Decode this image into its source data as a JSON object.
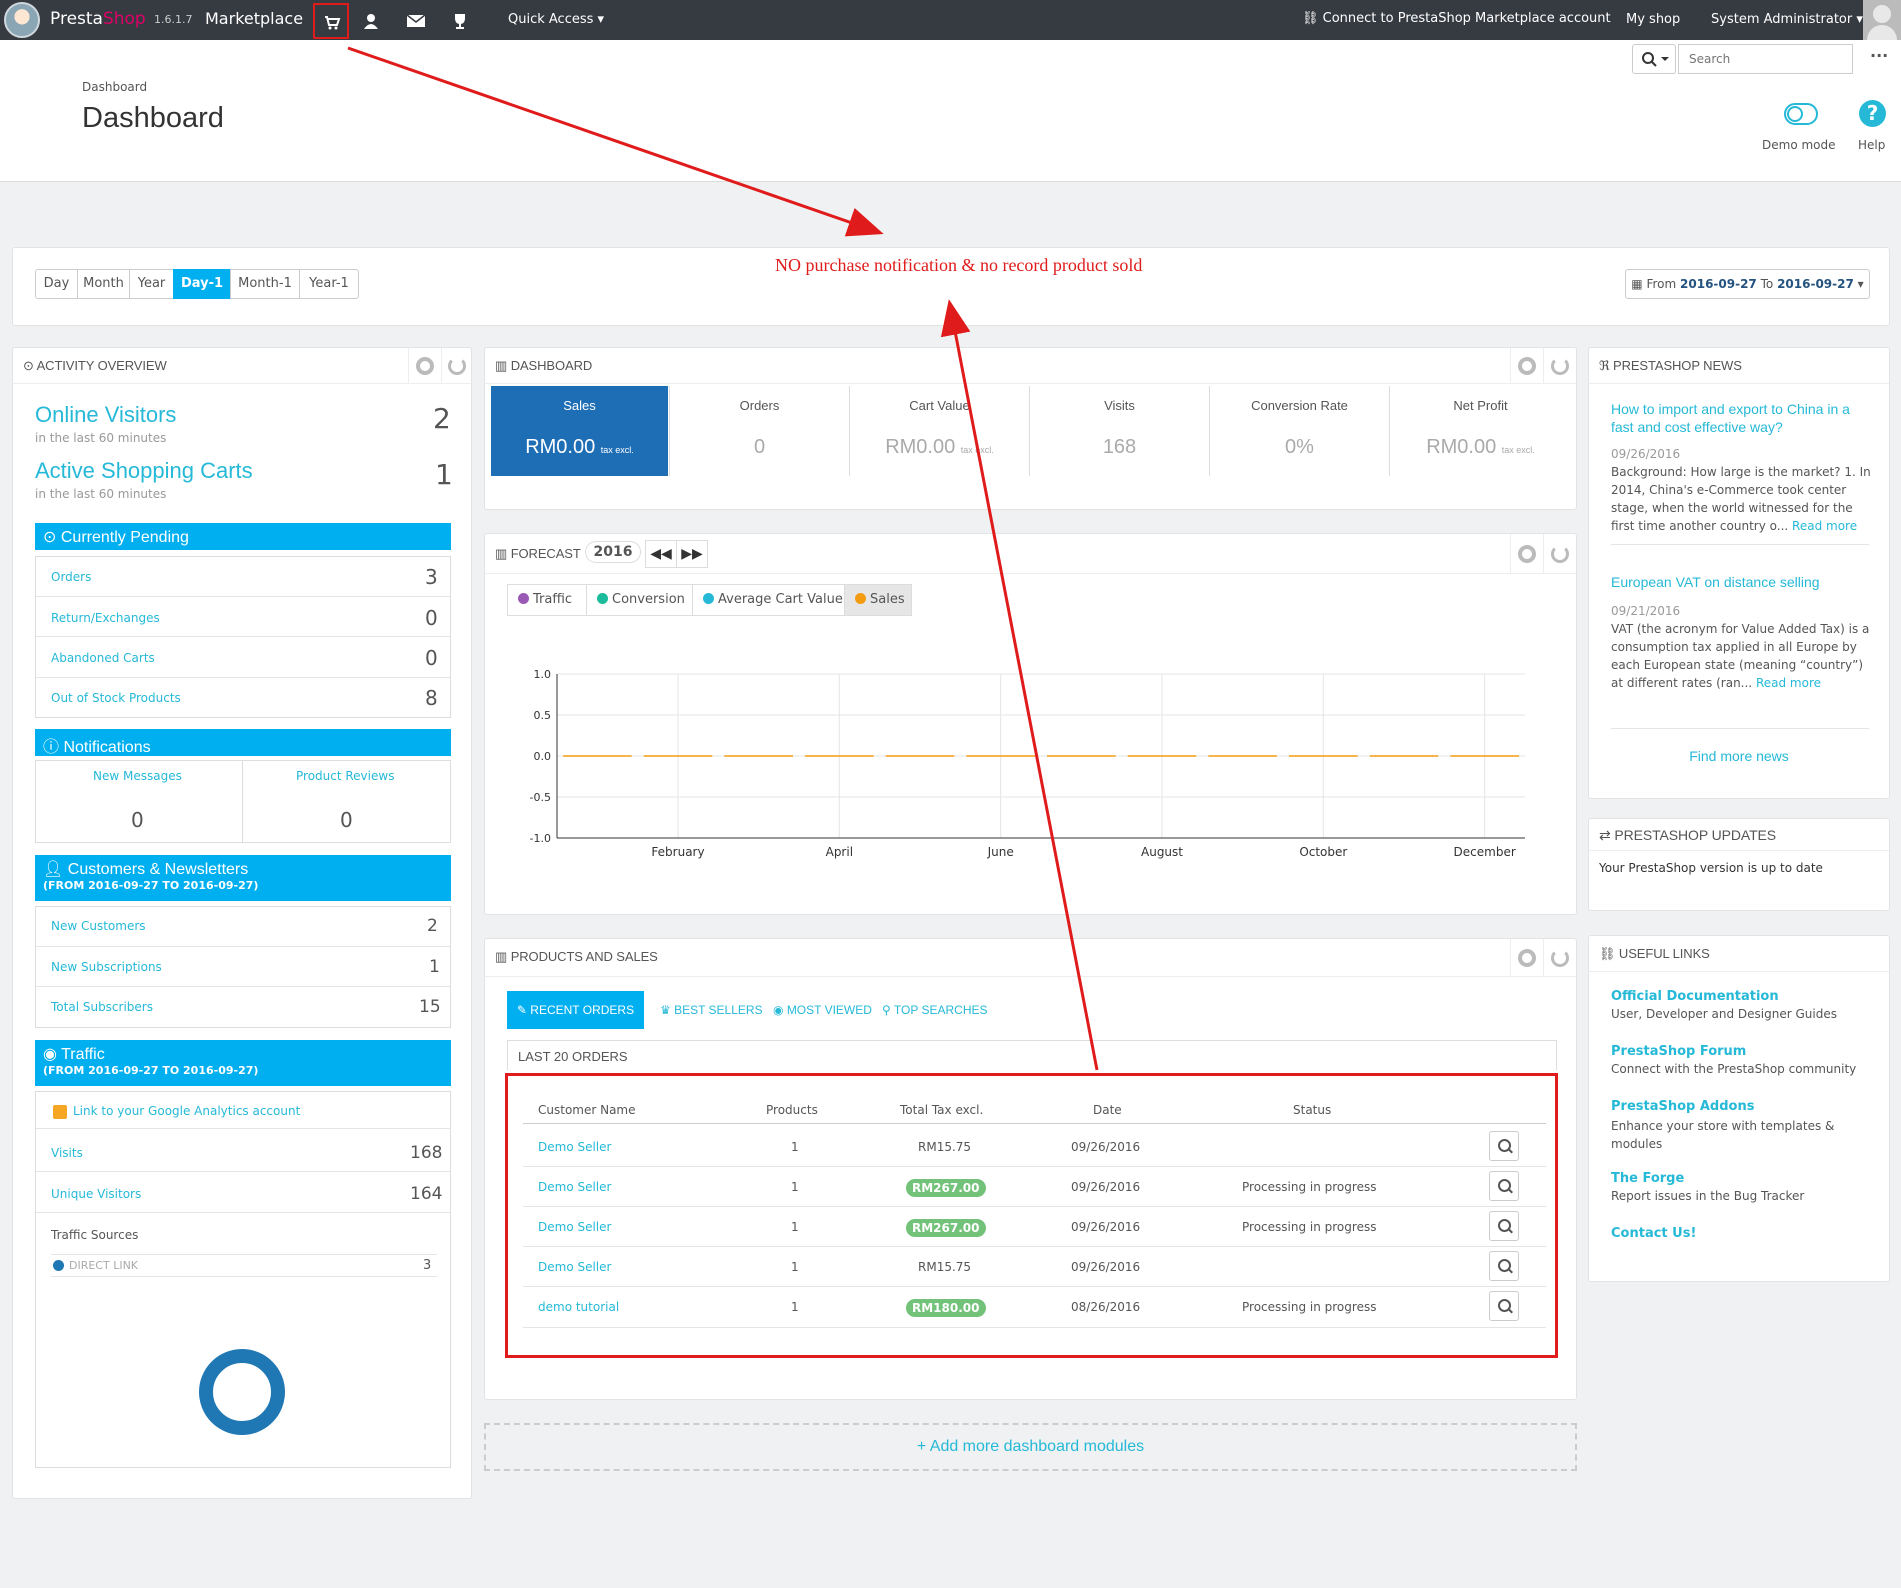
{
  "topbar": {
    "brand_a": "Presta",
    "brand_b": "Shop",
    "version": "1.6.1.7",
    "marketplace": "Marketplace",
    "quick_access": "Quick Access ▾",
    "connect": "Connect to PrestaShop Marketplace account",
    "my_shop": "My shop",
    "admin": "System Administrator ▾",
    "search_placeholder": "Search",
    "more": "···"
  },
  "header": {
    "breadcrumb": "Dashboard",
    "title": "Dashboard",
    "demo_mode": "Demo mode",
    "help": "Help"
  },
  "annotation": {
    "note": "NO purchase notification & no record product sold",
    "color": "#e01b1b"
  },
  "period": {
    "buttons": [
      "Day",
      "Month",
      "Year",
      "Day-1",
      "Month-1",
      "Year-1"
    ],
    "active": "Day-1",
    "range_prefix": "From",
    "from": "2016-09-27",
    "range_mid": "To",
    "to": "2016-09-27"
  },
  "activity": {
    "title": "ACTIVITY OVERVIEW",
    "online_visitors": "Online Visitors",
    "online_visitors_value": "2",
    "online_sub": "in the last 60 minutes",
    "active_carts": "Active Shopping Carts",
    "active_carts_value": "1",
    "carts_sub": "in the last 60 minutes",
    "pending_title": "Currently Pending",
    "pending": [
      {
        "label": "Orders",
        "value": "3"
      },
      {
        "label": "Return/Exchanges",
        "value": "0"
      },
      {
        "label": "Abandoned Carts",
        "value": "0"
      },
      {
        "label": "Out of Stock Products",
        "value": "8"
      }
    ],
    "notifications_title": "Notifications",
    "new_messages": "New Messages",
    "new_messages_value": "0",
    "product_reviews": "Product Reviews",
    "product_reviews_value": "0",
    "customers_title": "Customers & Newsletters",
    "customers_range": "(FROM 2016-09-27 TO 2016-09-27)",
    "customers": [
      {
        "label": "New Customers",
        "value": "2"
      },
      {
        "label": "New Subscriptions",
        "value": "1"
      },
      {
        "label": "Total Subscribers",
        "value": "15"
      }
    ],
    "traffic_title": "Traffic",
    "traffic_range": "(FROM 2016-09-27 TO 2016-09-27)",
    "analytics_link": "Link to your Google Analytics account",
    "traffic": [
      {
        "label": "Visits",
        "value": "168"
      },
      {
        "label": "Unique Visitors",
        "value": "164"
      }
    ],
    "traffic_sources": "Traffic Sources",
    "direct_link": "DIRECT LINK",
    "direct_link_value": "3"
  },
  "dashboard": {
    "title": "DASHBOARD",
    "kpis": [
      {
        "label": "Sales",
        "value": "RM0.00",
        "unit": "tax excl."
      },
      {
        "label": "Orders",
        "value": "0",
        "unit": ""
      },
      {
        "label": "Cart Value",
        "value": "RM0.00",
        "unit": "tax excl."
      },
      {
        "label": "Visits",
        "value": "168",
        "unit": ""
      },
      {
        "label": "Conversion Rate",
        "value": "0%",
        "unit": ""
      },
      {
        "label": "Net Profit",
        "value": "RM0.00",
        "unit": "tax excl."
      }
    ]
  },
  "forecast": {
    "title": "FORECAST",
    "year": "2016",
    "legend": [
      "Traffic",
      "Conversion",
      "Average Cart Value",
      "Sales"
    ],
    "legend_colors": [
      "#9b59b6",
      "#1abc9c",
      "#25b9d7",
      "#f39c12"
    ],
    "active_legend": "Sales"
  },
  "chart_data": {
    "type": "line",
    "x": [
      "January",
      "February",
      "March",
      "April",
      "May",
      "June",
      "July",
      "August",
      "September",
      "October",
      "November",
      "December"
    ],
    "xticks": [
      "February",
      "April",
      "June",
      "August",
      "October",
      "December"
    ],
    "yticks": [
      "1.0",
      "0.5",
      "0.0",
      "-0.5",
      "-1.0"
    ],
    "ylim": [
      -1,
      1
    ],
    "series": [
      {
        "name": "Sales",
        "values": [
          0,
          0,
          0,
          0,
          0,
          0,
          0,
          0,
          0,
          0,
          0,
          0
        ],
        "color": "#f39c12"
      }
    ]
  },
  "products_sales": {
    "title": "PRODUCTS AND SALES",
    "tabs": [
      "RECENT ORDERS",
      "BEST SELLERS",
      "MOST VIEWED",
      "TOP SEARCHES"
    ],
    "sub_title": "LAST 20 ORDERS",
    "columns": [
      "Customer Name",
      "Products",
      "Total Tax excl.",
      "Date",
      "Status"
    ],
    "rows": [
      {
        "customer": "Demo Seller",
        "products": "1",
        "total": "RM15.75",
        "badge": false,
        "date": "09/26/2016",
        "status": ""
      },
      {
        "customer": "Demo Seller",
        "products": "1",
        "total": "RM267.00",
        "badge": true,
        "date": "09/26/2016",
        "status": "Processing in progress"
      },
      {
        "customer": "Demo Seller",
        "products": "1",
        "total": "RM267.00",
        "badge": true,
        "date": "09/26/2016",
        "status": "Processing in progress"
      },
      {
        "customer": "Demo Seller",
        "products": "1",
        "total": "RM15.75",
        "badge": false,
        "date": "09/26/2016",
        "status": ""
      },
      {
        "customer": "demo tutorial",
        "products": "1",
        "total": "RM180.00",
        "badge": true,
        "date": "08/26/2016",
        "status": "Processing in progress"
      }
    ]
  },
  "add_modules": "+ Add more dashboard modules",
  "news": {
    "title": "PRESTASHOP NEWS",
    "items": [
      {
        "title": "How to import and export to China in a fast and cost effective way?",
        "date": "09/26/2016",
        "body": "Background: How large is the market? 1. In 2014, China's e-Commerce took center stage, when the world witnessed for the first time another country o...",
        "more": "Read more"
      },
      {
        "title": "European VAT on distance selling",
        "date": "09/21/2016",
        "body": "VAT (the acronym for Value Added Tax) is a consumption tax applied in all Europe by each European state (meaning “country”) at different rates (ran...",
        "more": "Read more"
      }
    ],
    "find_more": "Find more news"
  },
  "updates": {
    "title": "PRESTASHOP UPDATES",
    "text": "Your PrestaShop version is up to date"
  },
  "links": {
    "title": "USEFUL LINKS",
    "items": [
      {
        "title": "Official Documentation",
        "desc": "User, Developer and Designer Guides"
      },
      {
        "title": "PrestaShop Forum",
        "desc": "Connect with the PrestaShop community"
      },
      {
        "title": "PrestaShop Addons",
        "desc": "Enhance your store with templates & modules"
      },
      {
        "title": "The Forge",
        "desc": "Report issues in the Bug Tracker"
      },
      {
        "title": "Contact Us!",
        "desc": ""
      }
    ]
  }
}
